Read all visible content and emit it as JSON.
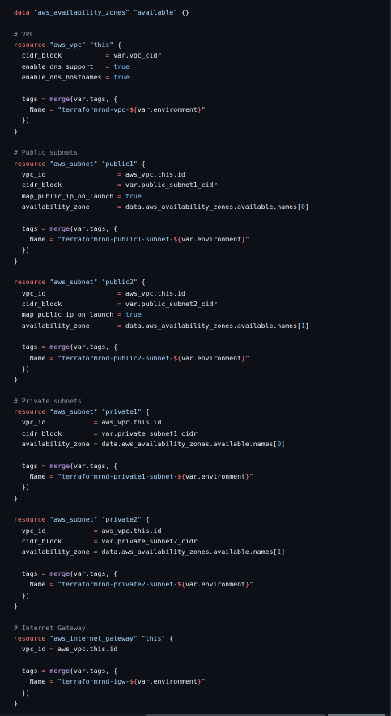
{
  "colors": {
    "background": "#0d1117",
    "default": "#e6edf3",
    "keyword": "#ff7b72",
    "string": "#a5d6ff",
    "function": "#d2a8ff",
    "comment": "#8b949e",
    "literal": "#79c0ff"
  },
  "lines": [
    [
      [
        "kw",
        "data"
      ],
      [
        "id",
        " "
      ],
      [
        "str",
        "\"aws_availability_zones\""
      ],
      [
        "id",
        " "
      ],
      [
        "str",
        "\"available\""
      ],
      [
        "id",
        " {}"
      ]
    ],
    [],
    [
      [
        "cm",
        "# VPC"
      ]
    ],
    [
      [
        "kw",
        "resource"
      ],
      [
        "id",
        " "
      ],
      [
        "str",
        "\"aws_vpc\""
      ],
      [
        "id",
        " "
      ],
      [
        "str",
        "\"this\""
      ],
      [
        "id",
        " {"
      ]
    ],
    [
      [
        "id",
        "  cidr_block           "
      ],
      [
        "op",
        "="
      ],
      [
        "id",
        " var.vpc_cidr"
      ]
    ],
    [
      [
        "id",
        "  enable_dns_support   "
      ],
      [
        "op",
        "="
      ],
      [
        "id",
        " "
      ],
      [
        "lit",
        "true"
      ]
    ],
    [
      [
        "id",
        "  enable_dns_hostnames "
      ],
      [
        "op",
        "="
      ],
      [
        "id",
        " "
      ],
      [
        "lit",
        "true"
      ]
    ],
    [],
    [
      [
        "id",
        "  tags "
      ],
      [
        "op",
        "="
      ],
      [
        "id",
        " "
      ],
      [
        "fn",
        "merge"
      ],
      [
        "id",
        "(var.tags, {"
      ]
    ],
    [
      [
        "id",
        "    Name "
      ],
      [
        "op",
        "="
      ],
      [
        "id",
        " "
      ],
      [
        "str",
        "\"terraformrnd-vpc-"
      ],
      [
        "op",
        "${"
      ],
      [
        "id",
        "var.environment"
      ],
      [
        "op",
        "}"
      ],
      [
        "str",
        "\""
      ]
    ],
    [
      [
        "id",
        "  })"
      ]
    ],
    [
      [
        "id",
        "}"
      ]
    ],
    [],
    [
      [
        "cm",
        "# Public subnets"
      ]
    ],
    [
      [
        "kw",
        "resource"
      ],
      [
        "id",
        " "
      ],
      [
        "str",
        "\"aws_subnet\""
      ],
      [
        "id",
        " "
      ],
      [
        "str",
        "\"public1\""
      ],
      [
        "id",
        " {"
      ]
    ],
    [
      [
        "id",
        "  vpc_id                  "
      ],
      [
        "op",
        "="
      ],
      [
        "id",
        " aws_vpc.this.id"
      ]
    ],
    [
      [
        "id",
        "  cidr_block              "
      ],
      [
        "op",
        "="
      ],
      [
        "id",
        " var.public_subnet1_cidr"
      ]
    ],
    [
      [
        "id",
        "  map_public_ip_on_launch "
      ],
      [
        "op",
        "="
      ],
      [
        "id",
        " "
      ],
      [
        "lit",
        "true"
      ]
    ],
    [
      [
        "id",
        "  availability_zone       "
      ],
      [
        "op",
        "="
      ],
      [
        "id",
        " data.aws_availability_zones.available.names["
      ],
      [
        "num",
        "0"
      ],
      [
        "id",
        "]"
      ]
    ],
    [],
    [
      [
        "id",
        "  tags "
      ],
      [
        "op",
        "="
      ],
      [
        "id",
        " "
      ],
      [
        "fn",
        "merge"
      ],
      [
        "id",
        "(var.tags, {"
      ]
    ],
    [
      [
        "id",
        "    Name "
      ],
      [
        "op",
        "="
      ],
      [
        "id",
        " "
      ],
      [
        "str",
        "\"terraformrnd-public1-subnet-"
      ],
      [
        "op",
        "${"
      ],
      [
        "id",
        "var.environment"
      ],
      [
        "op",
        "}"
      ],
      [
        "str",
        "\""
      ]
    ],
    [
      [
        "id",
        "  })"
      ]
    ],
    [
      [
        "id",
        "}"
      ]
    ],
    [],
    [
      [
        "kw",
        "resource"
      ],
      [
        "id",
        " "
      ],
      [
        "str",
        "\"aws_subnet\""
      ],
      [
        "id",
        " "
      ],
      [
        "str",
        "\"public2\""
      ],
      [
        "id",
        " {"
      ]
    ],
    [
      [
        "id",
        "  vpc_id                  "
      ],
      [
        "op",
        "="
      ],
      [
        "id",
        " aws_vpc.this.id"
      ]
    ],
    [
      [
        "id",
        "  cidr_block              "
      ],
      [
        "op",
        "="
      ],
      [
        "id",
        " var.public_subnet2_cidr"
      ]
    ],
    [
      [
        "id",
        "  map_public_ip_on_launch "
      ],
      [
        "op",
        "="
      ],
      [
        "id",
        " "
      ],
      [
        "lit",
        "true"
      ]
    ],
    [
      [
        "id",
        "  availability_zone       "
      ],
      [
        "op",
        "="
      ],
      [
        "id",
        " data.aws_availability_zones.available.names["
      ],
      [
        "num",
        "1"
      ],
      [
        "id",
        "]"
      ]
    ],
    [],
    [
      [
        "id",
        "  tags "
      ],
      [
        "op",
        "="
      ],
      [
        "id",
        " "
      ],
      [
        "fn",
        "merge"
      ],
      [
        "id",
        "(var.tags, {"
      ]
    ],
    [
      [
        "id",
        "    Name "
      ],
      [
        "op",
        "="
      ],
      [
        "id",
        " "
      ],
      [
        "str",
        "\"terraformrnd-public2-subnet-"
      ],
      [
        "op",
        "${"
      ],
      [
        "id",
        "var.environment"
      ],
      [
        "op",
        "}"
      ],
      [
        "str",
        "\""
      ]
    ],
    [
      [
        "id",
        "  })"
      ]
    ],
    [
      [
        "id",
        "}"
      ]
    ],
    [],
    [
      [
        "cm",
        "# Private subnets"
      ]
    ],
    [
      [
        "kw",
        "resource"
      ],
      [
        "id",
        " "
      ],
      [
        "str",
        "\"aws_subnet\""
      ],
      [
        "id",
        " "
      ],
      [
        "str",
        "\"private1\""
      ],
      [
        "id",
        " {"
      ]
    ],
    [
      [
        "id",
        "  vpc_id            "
      ],
      [
        "op",
        "="
      ],
      [
        "id",
        " aws_vpc.this.id"
      ]
    ],
    [
      [
        "id",
        "  cidr_block        "
      ],
      [
        "op",
        "="
      ],
      [
        "id",
        " var.private_subnet1_cidr"
      ]
    ],
    [
      [
        "id",
        "  availability_zone "
      ],
      [
        "op",
        "="
      ],
      [
        "id",
        " data.aws_availability_zones.available.names["
      ],
      [
        "num",
        "0"
      ],
      [
        "id",
        "]"
      ]
    ],
    [],
    [
      [
        "id",
        "  tags "
      ],
      [
        "op",
        "="
      ],
      [
        "id",
        " "
      ],
      [
        "fn",
        "merge"
      ],
      [
        "id",
        "(var.tags, {"
      ]
    ],
    [
      [
        "id",
        "    Name "
      ],
      [
        "op",
        "="
      ],
      [
        "id",
        " "
      ],
      [
        "str",
        "\"terraformrnd-private1-subnet-"
      ],
      [
        "op",
        "${"
      ],
      [
        "id",
        "var.environment"
      ],
      [
        "op",
        "}"
      ],
      [
        "str",
        "\""
      ]
    ],
    [
      [
        "id",
        "  })"
      ]
    ],
    [
      [
        "id",
        "}"
      ]
    ],
    [],
    [
      [
        "kw",
        "resource"
      ],
      [
        "id",
        " "
      ],
      [
        "str",
        "\"aws_subnet\""
      ],
      [
        "id",
        " "
      ],
      [
        "str",
        "\"private2\""
      ],
      [
        "id",
        " {"
      ]
    ],
    [
      [
        "id",
        "  vpc_id            "
      ],
      [
        "op",
        "="
      ],
      [
        "id",
        " aws_vpc.this.id"
      ]
    ],
    [
      [
        "id",
        "  cidr_block        "
      ],
      [
        "op",
        "="
      ],
      [
        "id",
        " var.private_subnet2_cidr"
      ]
    ],
    [
      [
        "id",
        "  availability_zone "
      ],
      [
        "op",
        "="
      ],
      [
        "id",
        " data.aws_availability_zones.available.names["
      ],
      [
        "num",
        "1"
      ],
      [
        "id",
        "]"
      ]
    ],
    [],
    [
      [
        "id",
        "  tags "
      ],
      [
        "op",
        "="
      ],
      [
        "id",
        " "
      ],
      [
        "fn",
        "merge"
      ],
      [
        "id",
        "(var.tags, {"
      ]
    ],
    [
      [
        "id",
        "    Name "
      ],
      [
        "op",
        "="
      ],
      [
        "id",
        " "
      ],
      [
        "str",
        "\"terraformrnd-private2-subnet-"
      ],
      [
        "op",
        "${"
      ],
      [
        "id",
        "var.environment"
      ],
      [
        "op",
        "}"
      ],
      [
        "str",
        "\""
      ]
    ],
    [
      [
        "id",
        "  })"
      ]
    ],
    [
      [
        "id",
        "}"
      ]
    ],
    [],
    [
      [
        "cm",
        "# Internet Gateway"
      ]
    ],
    [
      [
        "kw",
        "resource"
      ],
      [
        "id",
        " "
      ],
      [
        "str",
        "\"aws_internet_gateway\""
      ],
      [
        "id",
        " "
      ],
      [
        "str",
        "\"this\""
      ],
      [
        "id",
        " {"
      ]
    ],
    [
      [
        "id",
        "  vpc_id "
      ],
      [
        "op",
        "="
      ],
      [
        "id",
        " aws_vpc.this.id"
      ]
    ],
    [],
    [
      [
        "id",
        "  tags "
      ],
      [
        "op",
        "="
      ],
      [
        "id",
        " "
      ],
      [
        "fn",
        "merge"
      ],
      [
        "id",
        "(var.tags, {"
      ]
    ],
    [
      [
        "id",
        "    Name "
      ],
      [
        "op",
        "="
      ],
      [
        "id",
        " "
      ],
      [
        "str",
        "\"terraformrnd-igw-"
      ],
      [
        "op",
        "${"
      ],
      [
        "id",
        "var.environment"
      ],
      [
        "op",
        "}"
      ],
      [
        "str",
        "\""
      ]
    ],
    [
      [
        "id",
        "  })"
      ]
    ],
    [
      [
        "id",
        "}"
      ]
    ]
  ]
}
